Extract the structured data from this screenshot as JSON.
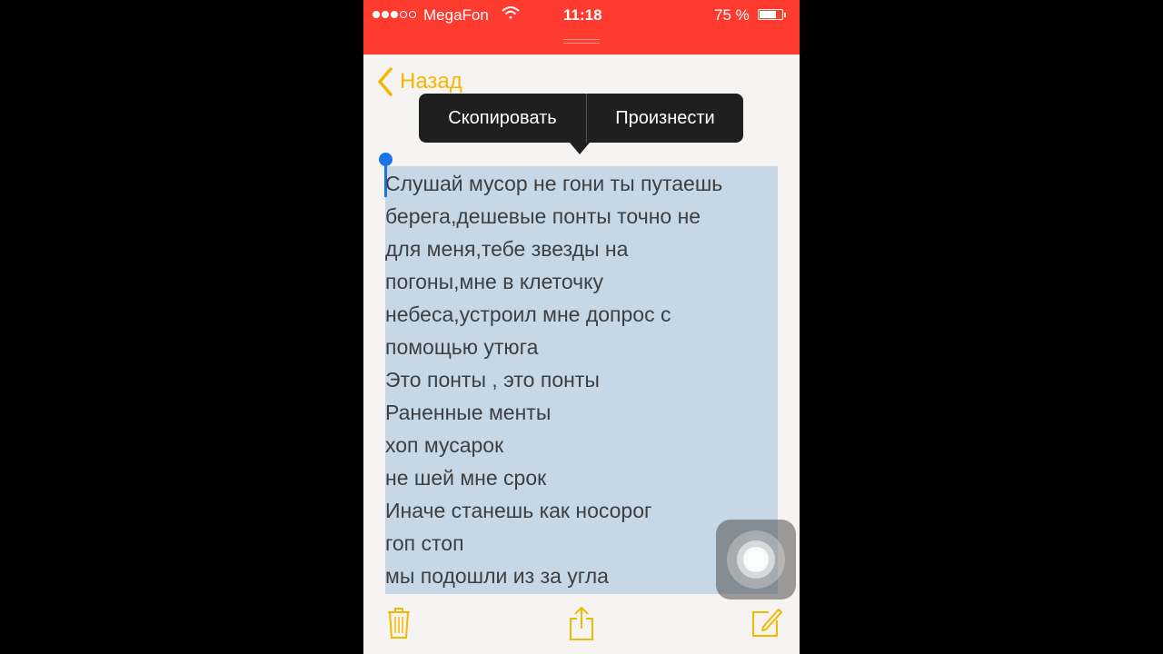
{
  "status_bar": {
    "signal_icon": "signal-dots-icon",
    "signal_bars": 3,
    "signal_max": 5,
    "carrier": "MegaFon",
    "wifi_icon": "wifi-icon",
    "time": "11:18",
    "battery_text": "75 %",
    "battery_level": 0.75,
    "battery_icon": "battery-icon",
    "background_color": "#ff3b30"
  },
  "nav": {
    "back_label": "Назад",
    "back_icon": "chevron-left-icon",
    "accent_color": "#f5b800"
  },
  "context_menu": {
    "copy_label": "Скопировать",
    "speak_label": "Произнести"
  },
  "note": {
    "lines": [
      "Слушай мусор не гони ты путаешь",
      "берега,дешевые понты точно не",
      "для меня,тебе звезды на",
      "погоны,мне в клеточку",
      "небеса,устроил мне допрос с",
      "помощью утюга",
      "Это понты , это понты",
      "Раненные менты",
      "хоп мусарок",
      "не шей мне срок",
      "Иначе станешь как носорог",
      "гоп стоп",
      "мы подошли из за угла"
    ],
    "selection_color": "#c6d7e6",
    "caret_color": "#1a73e8"
  },
  "toolbar": {
    "trash_icon": "trash-icon",
    "share_icon": "share-icon",
    "compose_icon": "compose-icon"
  },
  "assistive_touch_icon": "assistive-touch-icon"
}
